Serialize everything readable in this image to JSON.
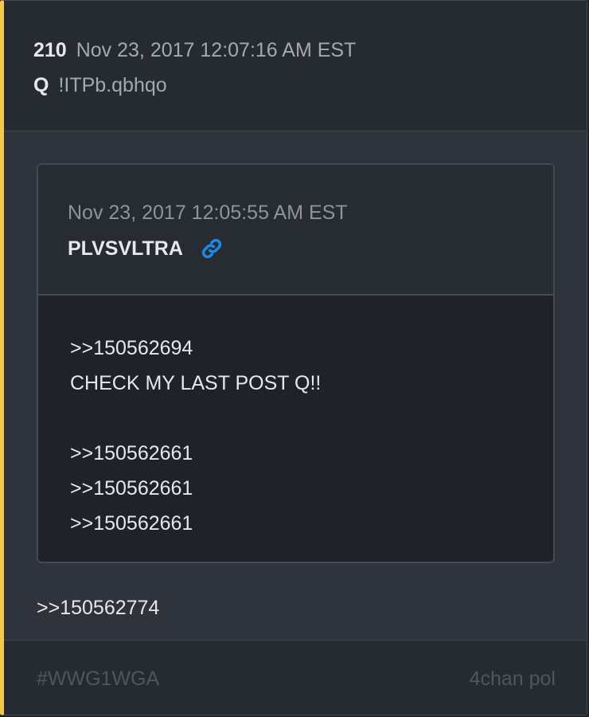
{
  "post": {
    "number": "210",
    "date": "Nov 23, 2017 12:07:16 AM EST",
    "author": "Q",
    "tripcode": "!ITPb.qbhqo",
    "accent_color": "#f2c94c"
  },
  "quoted_post": {
    "date": "Nov 23, 2017 12:05:55 AM EST",
    "author": "PLVSVLTRA",
    "link_icon": "link-icon",
    "link_color": "#1e88e5",
    "lines": [
      ">>150562694",
      "CHECK MY LAST POST Q!!",
      "",
      ">>150562661",
      ">>150562661",
      ">>150562661"
    ]
  },
  "reply": {
    "text": ">>150562774"
  },
  "footer": {
    "tag": "#WWG1WGA",
    "source": "4chan pol"
  }
}
